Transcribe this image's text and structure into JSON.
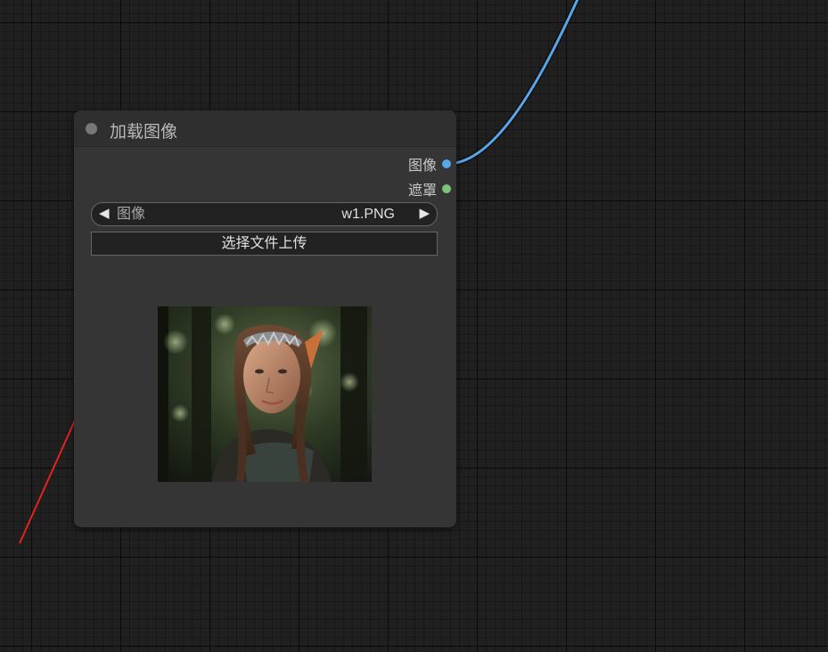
{
  "node": {
    "title": "加载图像",
    "outputs": [
      {
        "label": "图像",
        "color": "#5aa4e8"
      },
      {
        "label": "遮罩",
        "color": "#7cc47e"
      }
    ],
    "image_widget": {
      "name": "图像",
      "value": "w1.PNG",
      "left_arrow": "◀",
      "right_arrow": "▶"
    },
    "upload_label": "选择文件上传"
  },
  "colors": {
    "link_image": "#5aa4e8",
    "annotation_arrow": "#e3231e",
    "node_bg": "#353535",
    "canvas_bg": "#202020"
  }
}
